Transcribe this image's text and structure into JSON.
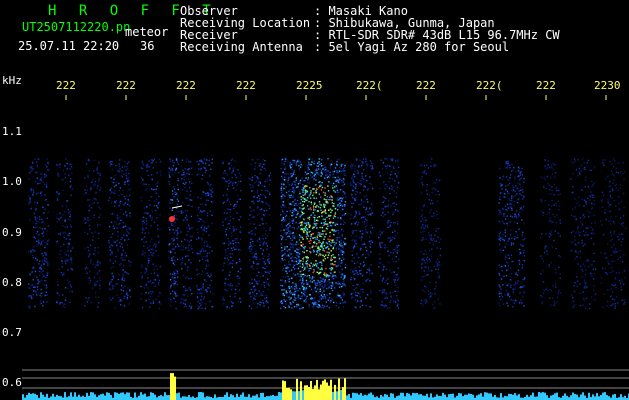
{
  "header": {
    "app_title": "H R O F F T",
    "file_name": "UT2507112220.pn",
    "tag": "meteor",
    "timestamp": "25.07.11 22:20",
    "count": "36",
    "info_labels": {
      "observer": "Observer",
      "location": "Receiving Location",
      "receiver": "Receiver",
      "antenna": "Receiving Antenna"
    },
    "info_values": {
      "observer": ": Masaki Kano",
      "location": ": Shibukawa, Gunma, Japan",
      "receiver": ": RTL-SDR SDR# 43dB L15 96.7MHz CW",
      "antenna": ": 5el Yagi Az 280 for Seoul"
    }
  },
  "axis": {
    "unit": "kHz",
    "y_ticks": [
      "1.1",
      "1.0",
      "0.9",
      "0.8",
      "0.7",
      "0.6"
    ],
    "x_ticks": [
      "222",
      "222",
      "222",
      "222",
      "2225",
      "222(",
      "222",
      "222(",
      "222",
      "2230"
    ]
  },
  "colors": {
    "background": "#000000",
    "label_green": "#00ff00",
    "tick_yellow": "#ffff66",
    "text_white": "#ffffff"
  }
}
